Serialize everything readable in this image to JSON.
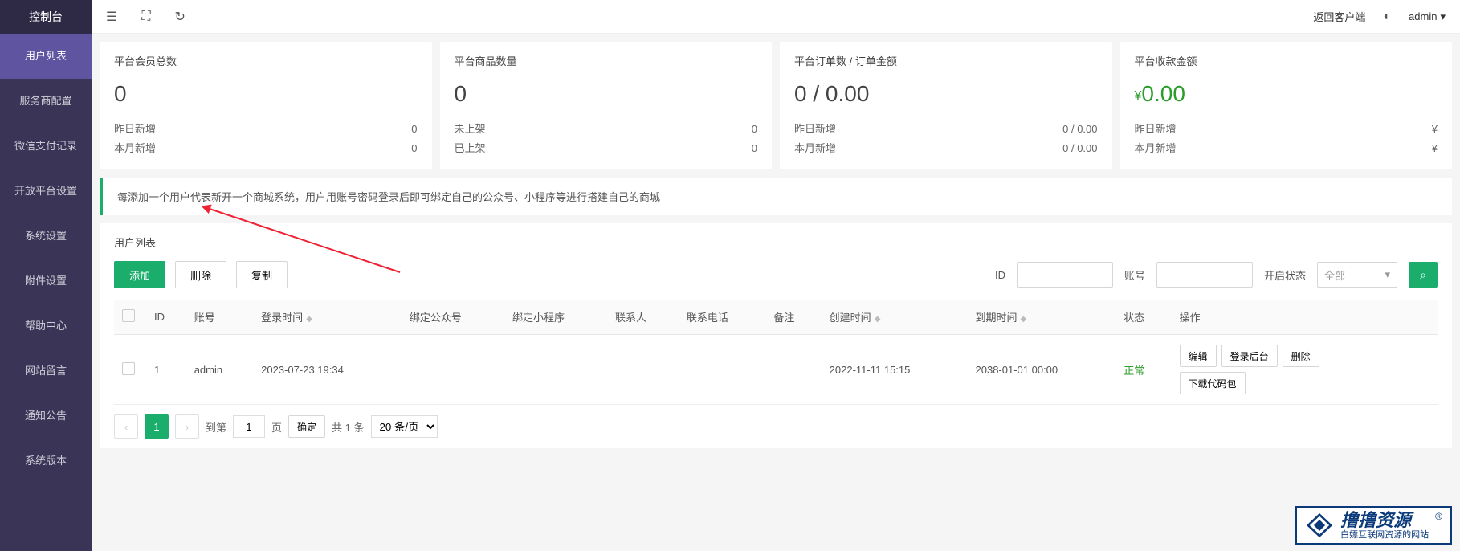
{
  "sidebar": {
    "title": "控制台",
    "items": [
      "用户列表",
      "服务商配置",
      "微信支付记录",
      "开放平台设置",
      "系统设置",
      "附件设置",
      "帮助中心",
      "网站留言",
      "通知公告",
      "系统版本"
    ]
  },
  "topbar": {
    "return_client": "返回客户端",
    "admin_name": "admin"
  },
  "stats": [
    {
      "title": "平台会员总数",
      "value": "0",
      "lines": [
        {
          "l": "昨日新增",
          "r": "0"
        },
        {
          "l": "本月新增",
          "r": "0"
        }
      ]
    },
    {
      "title": "平台商品数量",
      "value": "0",
      "lines": [
        {
          "l": "未上架",
          "r": "0"
        },
        {
          "l": "已上架",
          "r": "0"
        }
      ]
    },
    {
      "title": "平台订单数 / 订单金额",
      "value": "0 / 0.00",
      "lines": [
        {
          "l": "昨日新增",
          "r": "0 / 0.00"
        },
        {
          "l": "本月新增",
          "r": "0 / 0.00"
        }
      ]
    },
    {
      "title": "平台收款金额",
      "value": "0.00",
      "money": true,
      "lines": [
        {
          "l": "昨日新增",
          "r": "¥"
        },
        {
          "l": "本月新增",
          "r": "¥"
        }
      ]
    }
  ],
  "info_text": "每添加一个用户代表新开一个商城系统，用户用账号密码登录后即可绑定自己的公众号、小程序等进行搭建自己的商城",
  "panel": {
    "title": "用户列表",
    "add": "添加",
    "del": "删除",
    "copy": "复制",
    "filter_id": "ID",
    "filter_account": "账号",
    "filter_status": "开启状态",
    "filter_all": "全部"
  },
  "table": {
    "headers": [
      "",
      "ID",
      "账号",
      "登录时间",
      "绑定公众号",
      "绑定小程序",
      "联系人",
      "联系电话",
      "备注",
      "创建时间",
      "到期时间",
      "状态",
      "操作"
    ],
    "rows": [
      {
        "id": "1",
        "account": "admin",
        "login_time": "2023-07-23 19:34",
        "wechat": "",
        "miniprog": "",
        "contact": "",
        "phone": "",
        "remark": "",
        "created": "2022-11-11 15:15",
        "expires": "2038-01-01 00:00",
        "status": "正常"
      }
    ],
    "ops": {
      "edit": "编辑",
      "login_bg": "登录后台",
      "delete": "删除",
      "download": "下载代码包"
    }
  },
  "pagination": {
    "goto": "到第",
    "page_val": "1",
    "page_unit": "页",
    "confirm": "确定",
    "total": "共 1 条",
    "per_page": "20 条/页"
  },
  "watermark": {
    "main": "撸撸资源",
    "sub": "白嫖互联网资源的网站"
  }
}
